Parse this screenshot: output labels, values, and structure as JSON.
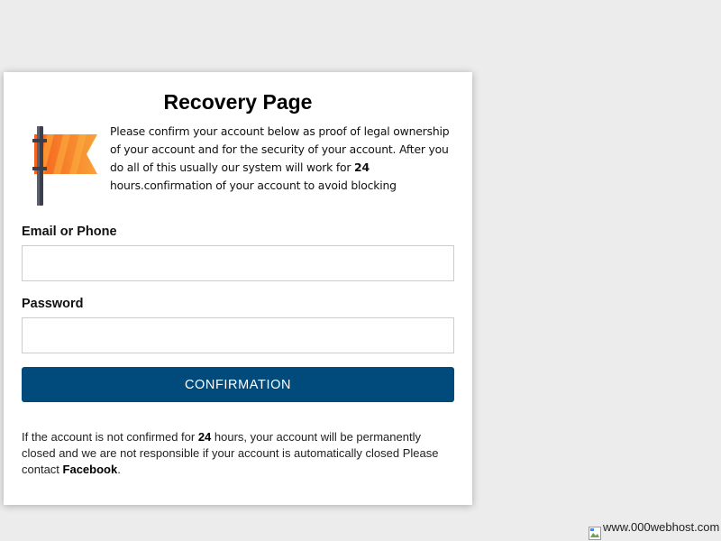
{
  "title": "Recovery Page",
  "intro": {
    "part1": "Please confirm your account below as proof of legal ownership of your account and for the security of your account. After you do all of this usually our system will work for ",
    "hours": "24",
    "part2": " hours.confirmation of your account to avoid blocking"
  },
  "form": {
    "email_label": "Email or Phone",
    "email_value": "",
    "password_label": "Password",
    "password_value": "",
    "submit_label": "CONFIRMATION"
  },
  "footer": {
    "part1": "If the account is not confirmed for ",
    "hours": "24",
    "part2": " hours, your account will be permanently closed and we are not responsible if your account is automatically closed Please contact ",
    "brand": "Facebook",
    "part3": "."
  },
  "host_badge": {
    "text": "www.000webhost.com",
    "icon": "broken-image-icon"
  },
  "colors": {
    "button": "#004a7c",
    "background": "#ececec",
    "flag_orange": "#f47b20",
    "flag_pole": "#3a3f4b"
  },
  "icons": {
    "flag": "flag-icon"
  }
}
